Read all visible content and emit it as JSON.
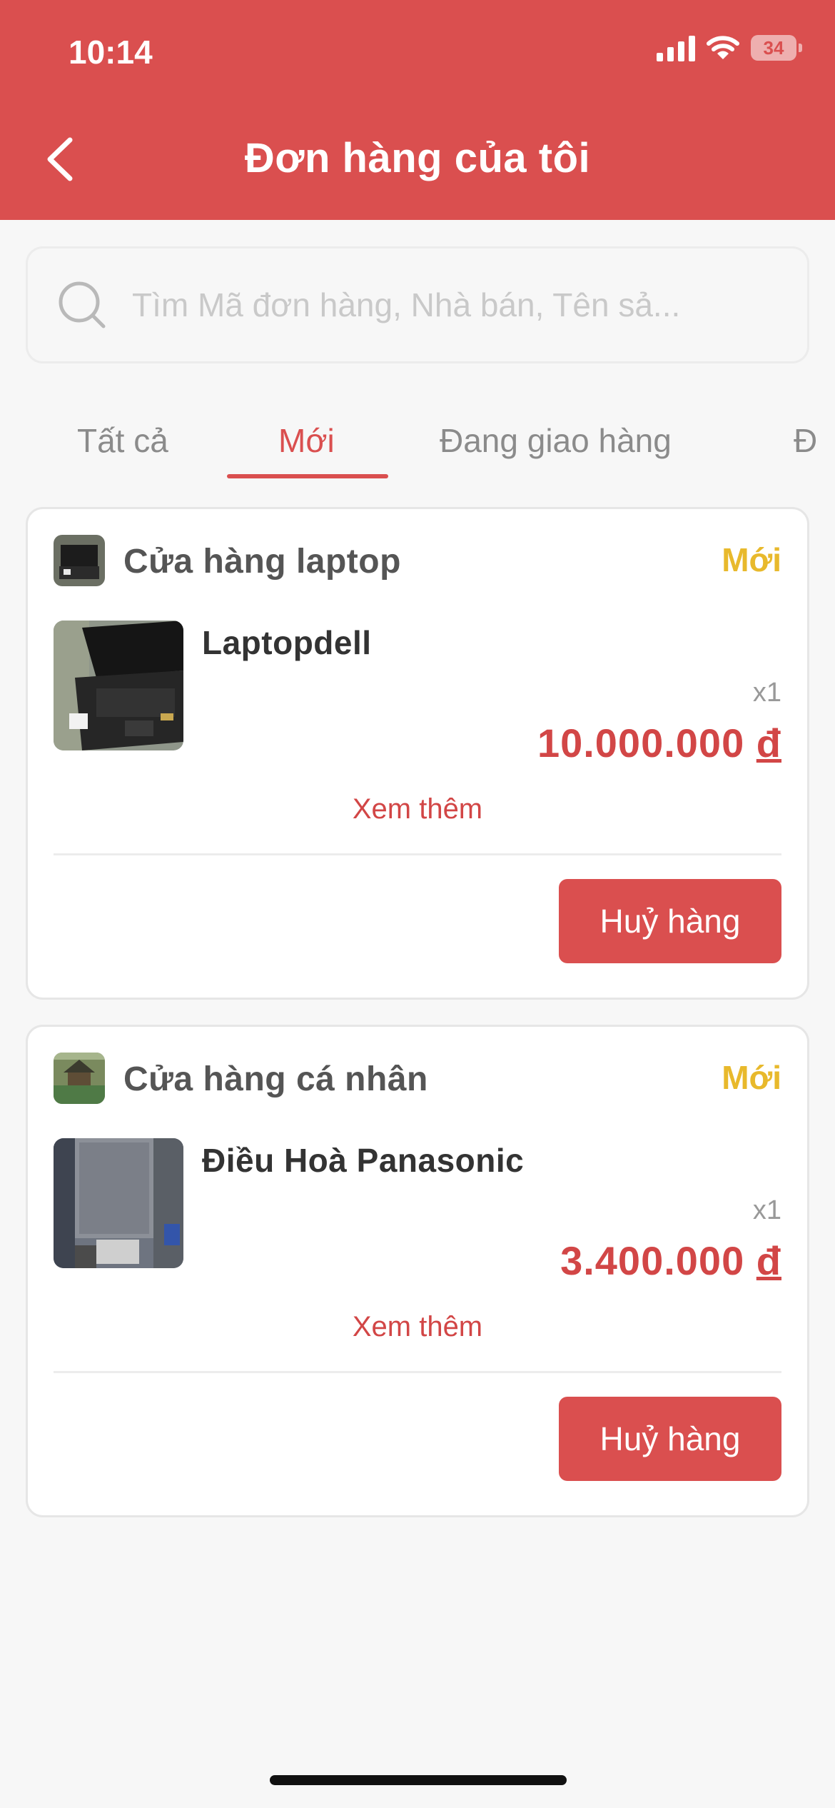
{
  "status_bar": {
    "time": "10:14",
    "battery": "34"
  },
  "header": {
    "title": "Đơn hàng của tôi"
  },
  "search": {
    "placeholder": "Tìm Mã đơn hàng, Nhà bán, Tên sả..."
  },
  "tabs": [
    {
      "label": "Tất cả",
      "active": false
    },
    {
      "label": "Mới",
      "active": true
    },
    {
      "label": "Đang giao hàng",
      "active": false
    },
    {
      "label": "Đ",
      "active": false
    }
  ],
  "orders": [
    {
      "shop_name": "Cửa hàng laptop",
      "status": "Mới",
      "product_name": "Laptopdell",
      "quantity": "x1",
      "price": "10.000.000",
      "currency": "đ",
      "see_more": "Xem thêm",
      "cancel_label": "Huỷ hàng"
    },
    {
      "shop_name": "Cửa hàng cá nhân",
      "status": "Mới",
      "product_name": "Điều Hoà Panasonic",
      "quantity": "x1",
      "price": "3.400.000",
      "currency": "đ",
      "see_more": "Xem thêm",
      "cancel_label": "Huỷ hàng"
    }
  ],
  "colors": {
    "brand": "#da4f4f",
    "status_new": "#e8b92c",
    "price": "#d24646"
  }
}
